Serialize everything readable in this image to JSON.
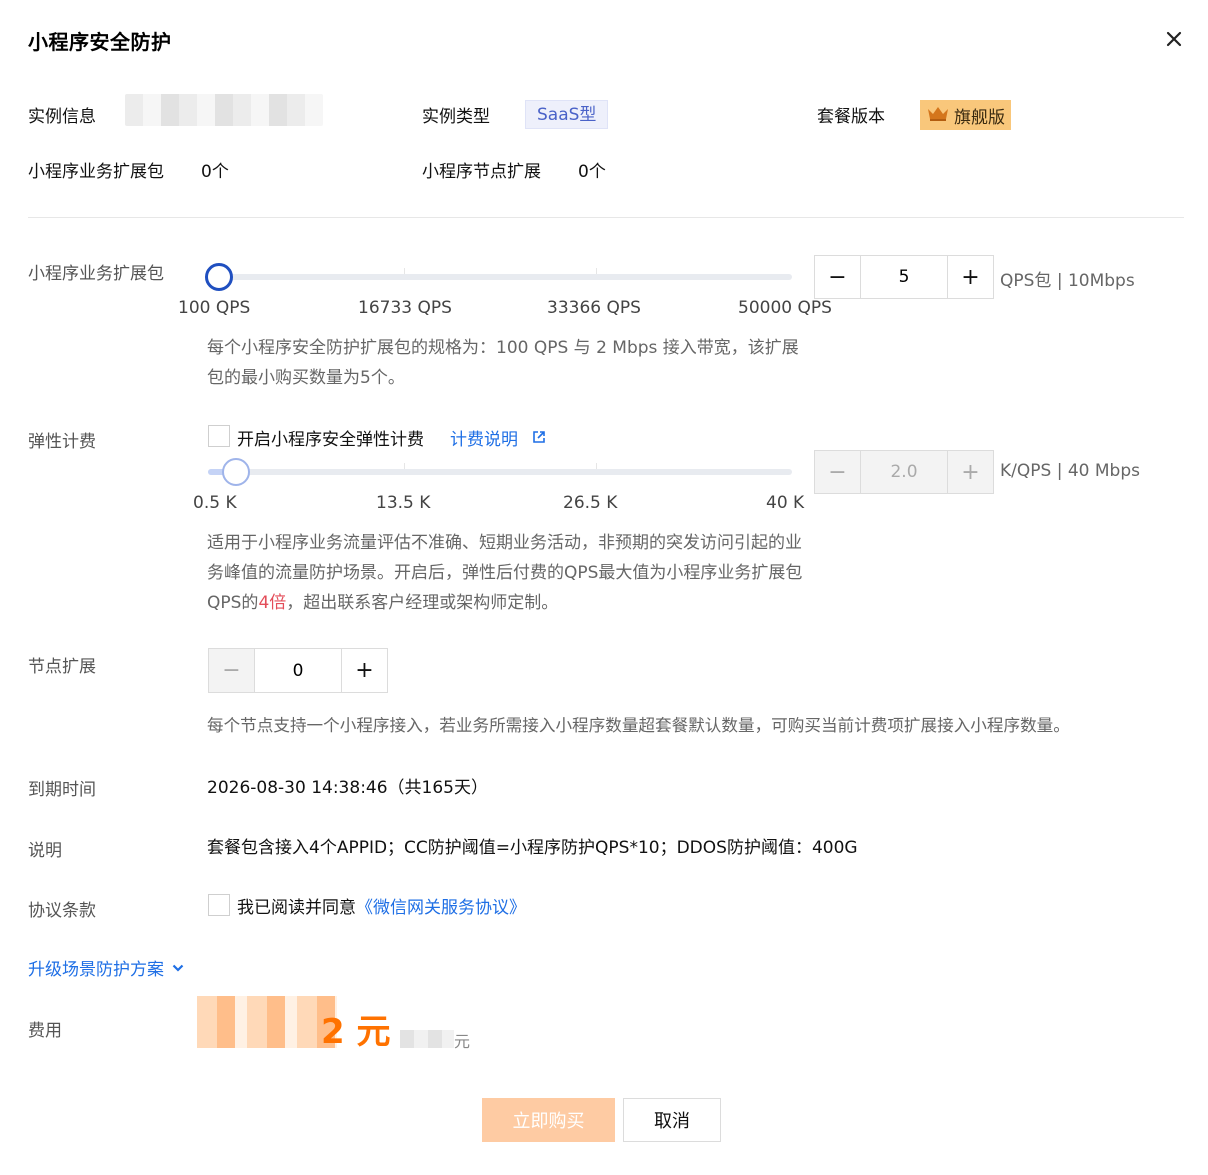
{
  "dialog": {
    "title": "小程序安全防护"
  },
  "info": {
    "instance_info_label": "实例信息",
    "instance_type_label": "实例类型",
    "instance_type_value": "SaaS型",
    "package_version_label": "套餐版本",
    "package_version_value": "旗舰版",
    "biz_pack_label": "小程序业务扩展包",
    "biz_pack_value": "0个",
    "node_ext_label": "小程序节点扩展",
    "node_ext_value": "0个"
  },
  "biz_pack": {
    "label": "小程序业务扩展包",
    "ticks": [
      "100 QPS",
      "16733 QPS",
      "33366 QPS",
      "50000 QPS"
    ],
    "slider_fraction": 0.0,
    "quantity": "5",
    "unit": "QPS包 | 10Mbps",
    "help": "每个小程序安全防护扩展包的规格为：100 QPS 与 2 Mbps 接入带宽，该扩展包的最小购买数量为5个。"
  },
  "elastic": {
    "label": "弹性计费",
    "checkbox_label": "开启小程序安全弹性计费",
    "billing_link": "计费说明",
    "ticks": [
      "0.5 K",
      "13.5 K",
      "26.5 K",
      "40 K"
    ],
    "slider_fraction": 0.04,
    "quantity": "2.0",
    "unit": "K/QPS | 40 Mbps",
    "help_part1": "适用于小程序业务流量评估不准确、短期业务活动，非预期的突发访问引起的业务峰值的流量防护场景。开启后，弹性后付费的QPS最大值为小程序业务扩展包QPS的",
    "help_highlight": "4倍",
    "help_part2": "，超出联系客户经理或架构师定制。"
  },
  "node_ext": {
    "label": "节点扩展",
    "quantity": "0",
    "help": "每个节点支持一个小程序接入，若业务所需接入小程序数量超套餐默认数量，可购买当前计费项扩展接入小程序数量。"
  },
  "expiry": {
    "label": "到期时间",
    "value": "2026-08-30 14:38:46（共165天）"
  },
  "description": {
    "label": "说明",
    "value": "套餐包含接入4个APPID；CC防护阈值=小程序防护QPS*10；DDOS防护阈值：400G"
  },
  "agreement": {
    "label": "协议条款",
    "text": "我已阅读并同意",
    "link": "《微信网关服务协议》"
  },
  "upgrade": {
    "label": "升级场景防护方案"
  },
  "fee": {
    "label": "费用",
    "price_suffix": "2 元",
    "original_suffix": "元"
  },
  "actions": {
    "buy": "立即购买",
    "cancel": "取消"
  },
  "colors": {
    "accent": "#1f6fe5",
    "price": "#ff7200",
    "highlight": "#e34d59",
    "buy_disabled": "#fecba3"
  }
}
